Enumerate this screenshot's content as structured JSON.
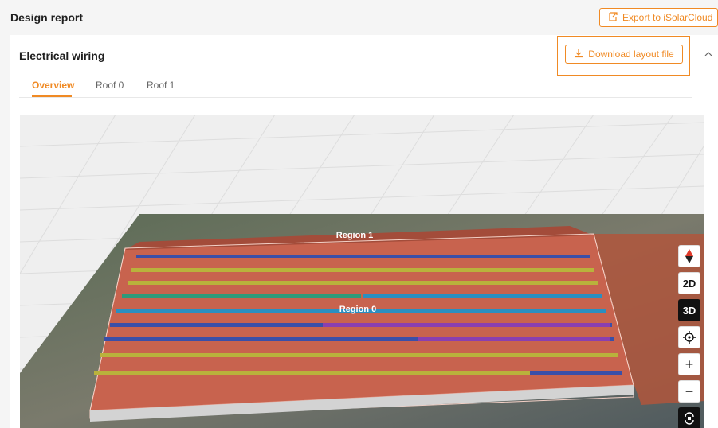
{
  "header": {
    "title": "Design report",
    "export_label": "Export to iSolarCloud",
    "export_icon": "export-icon"
  },
  "section": {
    "title": "Electrical wiring",
    "download_label": "Download layout file",
    "download_icon": "download-icon",
    "collapse_icon": "chevron-up-icon"
  },
  "tabs": [
    {
      "label": "Overview",
      "active": true
    },
    {
      "label": "Roof 0",
      "active": false
    },
    {
      "label": "Roof 1",
      "active": false
    }
  ],
  "viewer": {
    "regions": [
      "Region 1",
      "Region 0"
    ],
    "controls": {
      "compass_icon": "compass-icon",
      "mode_2d": "2D",
      "mode_3d": "3D",
      "active_mode": "3D",
      "locate_icon": "locate-icon",
      "zoom_in": "+",
      "zoom_out": "−",
      "reset_icon": "reset-view-icon"
    }
  },
  "colors": {
    "accent": "#f08a24",
    "roof": "#c8634e",
    "panel_blue": "#3a4fa8",
    "panel_yellow": "#b9b23c",
    "panel_teal": "#2f9a7a",
    "panel_purple": "#8a3fb0",
    "panel_cyan": "#2a8fc1"
  }
}
